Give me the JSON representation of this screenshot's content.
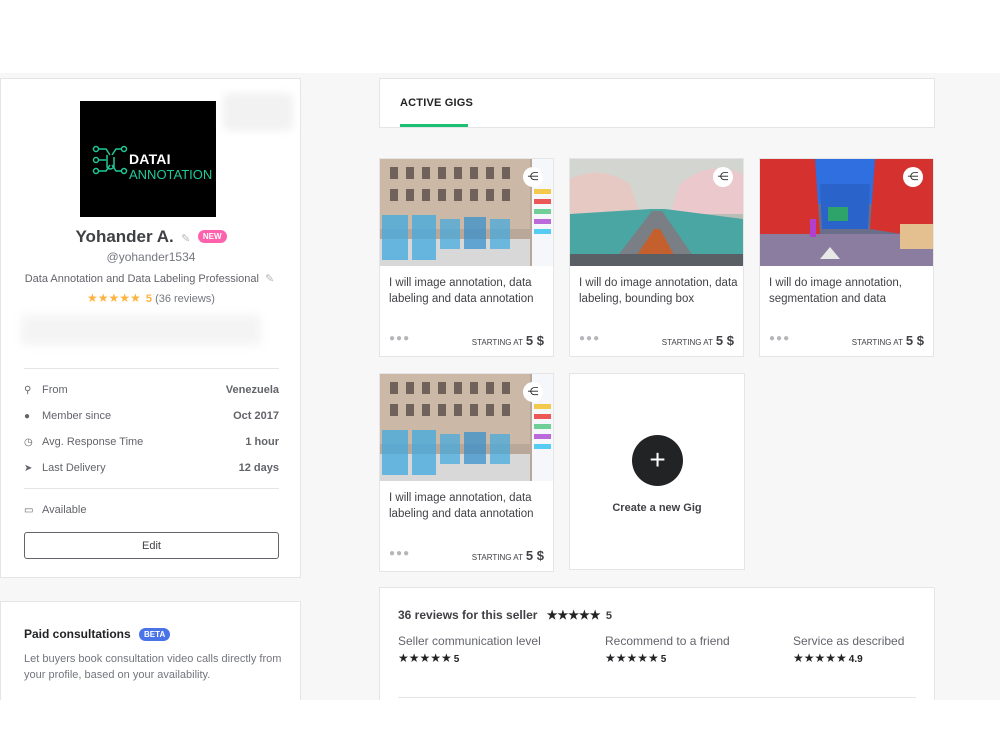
{
  "profile": {
    "logo_line1": "DATAI",
    "logo_line2": "ANNOTATION",
    "name": "Yohander A.",
    "new_badge": "NEW",
    "handle": "@yohander1534",
    "tagline": "Data Annotation and Data Labeling Professional",
    "rating": "5",
    "reviews_count": "(36 reviews)",
    "info": [
      {
        "label": "From",
        "value": "Venezuela",
        "icon": "location-pin-icon"
      },
      {
        "label": "Member since",
        "value": "Oct 2017",
        "icon": "user-icon"
      },
      {
        "label": "Avg. Response Time",
        "value": "1 hour",
        "icon": "clock-icon"
      },
      {
        "label": "Last Delivery",
        "value": "12 days",
        "icon": "send-icon"
      }
    ],
    "availability": "Available",
    "edit_label": "Edit"
  },
  "consultations": {
    "title": "Paid consultations",
    "badge": "BETA",
    "description": "Let buyers book consultation video calls directly from your profile, based on your availability."
  },
  "tabs": {
    "active": "ACTIVE GIGS"
  },
  "gigs": [
    {
      "title": "I will image annotation, data labeling and data annotation",
      "starting_at": "STARTING AT",
      "price": "5 $",
      "image": "street-building-annotation"
    },
    {
      "title": "I will do image annotation, data labeling, bounding box",
      "starting_at": "STARTING AT",
      "price": "5 $",
      "image": "road-segmentation"
    },
    {
      "title": "I will do image annotation, segmentation and data",
      "starting_at": "STARTING AT",
      "price": "5 $",
      "image": "city-segmentation"
    },
    {
      "title": "I will image annotation, data labeling and data annotation",
      "starting_at": "STARTING AT",
      "price": "5 $",
      "image": "street-building-annotation"
    }
  ],
  "create_gig": {
    "label": "Create a new Gig"
  },
  "reviews": {
    "title": "36 reviews for this seller",
    "overall": "5",
    "criteria": [
      {
        "label": "Seller communication level",
        "score": "5"
      },
      {
        "label": "Recommend to a friend",
        "score": "5"
      },
      {
        "label": "Service as described",
        "score": "4.9"
      }
    ]
  },
  "colors": {
    "accent_green": "#1dbf73",
    "star_orange": "#ffb33e",
    "new_pink": "#ff62ad",
    "beta_blue": "#4a73e8"
  }
}
